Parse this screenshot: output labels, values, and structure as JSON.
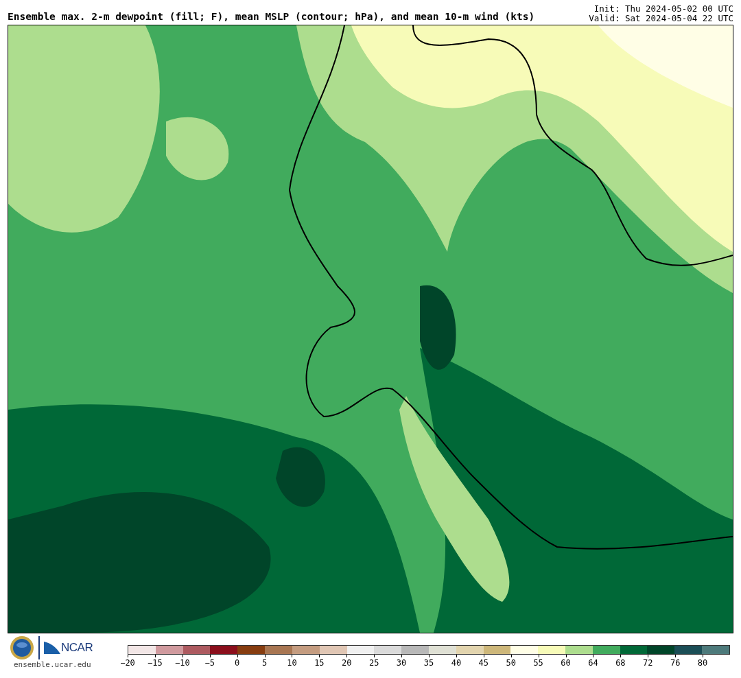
{
  "header": {
    "title": "Ensemble max. 2-m dewpoint (fill; F), mean MSLP (contour; hPa), and mean 10-m wind (kts)",
    "init": "Init: Thu 2024-05-02 00 UTC",
    "valid": "Valid: Sat 2024-05-04 22 UTC"
  },
  "footer": {
    "logo_text": "NCAR",
    "site": "ensemble.ucar.edu"
  },
  "colorbar": {
    "swatches": [
      {
        "color": "#f2e6e6"
      },
      {
        "color": "#d09a9e"
      },
      {
        "color": "#ad5a60"
      },
      {
        "color": "#8b0f1c"
      },
      {
        "color": "#873d10"
      },
      {
        "color": "#a87652"
      },
      {
        "color": "#c49c80"
      },
      {
        "color": "#e0c6b4"
      },
      {
        "color": "#f0f0f0"
      },
      {
        "color": "#dadada"
      },
      {
        "color": "#b8b8b8"
      },
      {
        "color": "#dfe0d4"
      },
      {
        "color": "#e2d4ae"
      },
      {
        "color": "#cdb77a"
      },
      {
        "color": "#fffee6"
      },
      {
        "color": "#f7fbb8"
      },
      {
        "color": "#addd8e"
      },
      {
        "color": "#41ab5d"
      },
      {
        "color": "#006837"
      },
      {
        "color": "#004529"
      },
      {
        "color": "#1b4e56"
      },
      {
        "color": "#4d7a7b"
      }
    ],
    "ticks": [
      "−20",
      "−15",
      "−10",
      "−5",
      "0",
      "5",
      "10",
      "15",
      "20",
      "25",
      "30",
      "35",
      "40",
      "45",
      "50",
      "55",
      "60",
      "64",
      "68",
      "72",
      "76",
      "80"
    ]
  }
}
